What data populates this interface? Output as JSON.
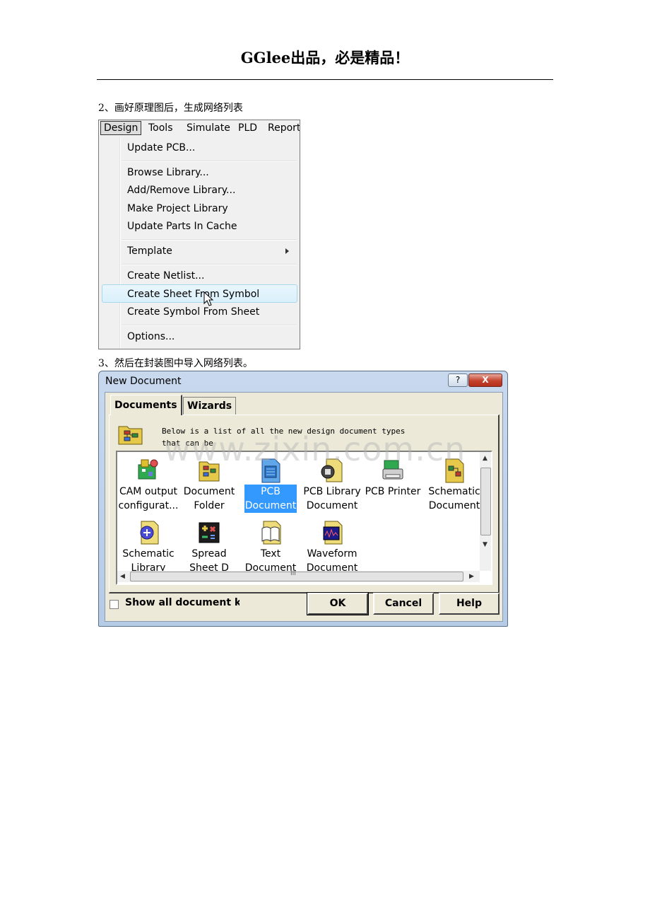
{
  "header": {
    "title": "GGlee出品，必是精品！"
  },
  "steps": {
    "step2": "2、画好原理图后，生成网络列表",
    "step3": "3、然后在封装图中导入网络列表。"
  },
  "menu_screenshot": {
    "menubar": [
      "Design",
      "Tools",
      "Simulate",
      "PLD",
      "Report"
    ],
    "items": {
      "update_pcb": "Update PCB...",
      "browse_library": "Browse Library...",
      "add_remove_library": "Add/Remove Library...",
      "make_project_library": "Make Project Library",
      "update_parts_in_cache": "Update Parts In Cache",
      "template": "Template",
      "create_netlist": "Create Netlist...",
      "create_sheet_from_symbol": "Create Sheet From Symbol",
      "create_symbol_from_sheet": "Create Symbol From Sheet",
      "options": "Options..."
    }
  },
  "dialog": {
    "title": "New Document",
    "title_help": "?",
    "title_close": "X",
    "tabs": [
      "Documents",
      "Wizards"
    ],
    "description_line1": "Below is a list of all the new design document types",
    "description_line2": "that can be",
    "items": [
      {
        "label": "CAM output\nconfigurat...",
        "icon": "cam-output-icon"
      },
      {
        "label": "Document\nFolder",
        "icon": "document-folder-icon"
      },
      {
        "label": "PCB\nDocument",
        "icon": "pcb-document-icon",
        "selected": true
      },
      {
        "label": "PCB Library\nDocument",
        "icon": "pcb-library-icon"
      },
      {
        "label": "PCB Printer",
        "icon": "pcb-printer-icon"
      },
      {
        "label": "Schematic\nDocument",
        "icon": "schematic-document-icon"
      },
      {
        "label": "Schematic\nLibrary",
        "icon": "schematic-library-icon"
      },
      {
        "label": "Spread\nSheet D",
        "icon": "spreadsheet-icon"
      },
      {
        "label": "Text\nDocument",
        "icon": "text-document-icon"
      },
      {
        "label": "Waveform\nDocument",
        "icon": "waveform-document-icon"
      }
    ],
    "hscroll_grip": "III",
    "show_all_label": "Show all document kinds",
    "buttons": {
      "ok": "OK",
      "cancel": "Cancel",
      "help": "Help"
    }
  },
  "watermark": "www.zixin.com.cn",
  "colors": {
    "selection": "#3399ff",
    "menu_highlight": "#d9f0fc",
    "dialog_face": "#ece9d8",
    "close_red": "#c4422e"
  }
}
